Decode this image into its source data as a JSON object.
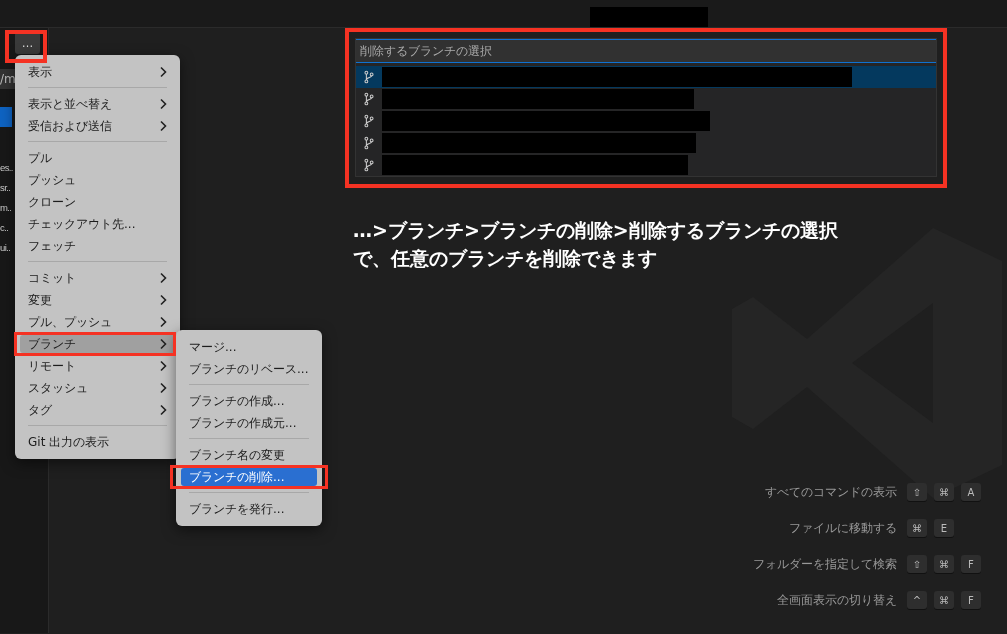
{
  "sidebar": {
    "more_button": "…",
    "path_fragment": "/m",
    "items": [
      "es..",
      "sr..",
      "m..",
      "c..",
      "ui.."
    ]
  },
  "menu": {
    "items": [
      {
        "kind": "item",
        "label": "表示",
        "submenu": true,
        "selected": false
      },
      {
        "kind": "separator"
      },
      {
        "kind": "item",
        "label": "表示と並べ替え",
        "submenu": true,
        "selected": false
      },
      {
        "kind": "item",
        "label": "受信および送信",
        "submenu": true,
        "selected": false
      },
      {
        "kind": "separator"
      },
      {
        "kind": "item",
        "label": "プル",
        "submenu": false,
        "selected": false
      },
      {
        "kind": "item",
        "label": "プッシュ",
        "submenu": false,
        "selected": false
      },
      {
        "kind": "item",
        "label": "クローン",
        "submenu": false,
        "selected": false
      },
      {
        "kind": "item",
        "label": "チェックアウト先...",
        "submenu": false,
        "selected": false
      },
      {
        "kind": "item",
        "label": "フェッチ",
        "submenu": false,
        "selected": false
      },
      {
        "kind": "separator"
      },
      {
        "kind": "item",
        "label": "コミット",
        "submenu": true,
        "selected": false
      },
      {
        "kind": "item",
        "label": "変更",
        "submenu": true,
        "selected": false
      },
      {
        "kind": "item",
        "label": "プル、プッシュ",
        "submenu": true,
        "selected": false
      },
      {
        "kind": "item",
        "label": "ブランチ",
        "submenu": true,
        "selected": true
      },
      {
        "kind": "item",
        "label": "リモート",
        "submenu": true,
        "selected": false
      },
      {
        "kind": "item",
        "label": "スタッシュ",
        "submenu": true,
        "selected": false
      },
      {
        "kind": "item",
        "label": "タグ",
        "submenu": true,
        "selected": false
      },
      {
        "kind": "separator"
      },
      {
        "kind": "item",
        "label": "Git 出力の表示",
        "submenu": false,
        "selected": false
      }
    ]
  },
  "submenu": {
    "items": [
      {
        "kind": "item",
        "label": "マージ...",
        "selected": false
      },
      {
        "kind": "item",
        "label": "ブランチのリベース...",
        "selected": false
      },
      {
        "kind": "separator"
      },
      {
        "kind": "item",
        "label": "ブランチの作成...",
        "selected": false
      },
      {
        "kind": "item",
        "label": "ブランチの作成元...",
        "selected": false
      },
      {
        "kind": "separator"
      },
      {
        "kind": "item",
        "label": "ブランチ名の変更",
        "selected": false
      },
      {
        "kind": "item",
        "label": "ブランチの削除...",
        "selected": true
      },
      {
        "kind": "separator"
      },
      {
        "kind": "item",
        "label": "ブランチを発行...",
        "selected": false
      }
    ]
  },
  "quick_pick": {
    "placeholder": "削除するブランチの選択",
    "branches": [
      {
        "selected": true
      },
      {
        "selected": false
      },
      {
        "selected": false
      },
      {
        "selected": false
      },
      {
        "selected": false
      }
    ]
  },
  "annotation": {
    "lines": [
      "…>ブランチ>ブランチの削除>削除するブランチの選択",
      "で、任意のブランチを削除できます"
    ]
  },
  "shortcuts": [
    {
      "label": "すべてのコマンドの表示",
      "keys": [
        "⇧",
        "⌘",
        "A"
      ]
    },
    {
      "label": "ファイルに移動する",
      "keys": [
        "⌘",
        "E"
      ]
    },
    {
      "label": "フォルダーを指定して検索",
      "keys": [
        "⇧",
        "⌘",
        "F"
      ]
    },
    {
      "label": "全画面表示の切り替え",
      "keys": [
        "^",
        "⌘",
        "F"
      ]
    }
  ]
}
